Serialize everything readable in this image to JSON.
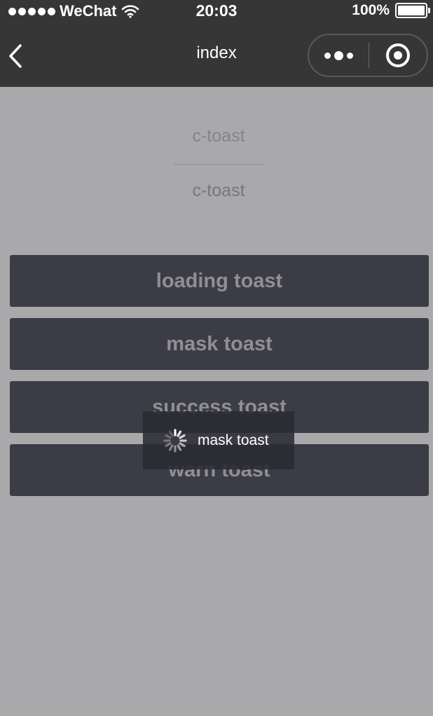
{
  "status_bar": {
    "carrier": "WeChat",
    "time": "20:03",
    "battery": "100%",
    "icons": [
      "signal-icon",
      "wifi-icon",
      "battery-icon"
    ]
  },
  "nav_bar": {
    "title": "index",
    "icons": [
      "back-icon",
      "more-icon",
      "target-icon"
    ]
  },
  "component": {
    "title": "c-toast",
    "subtitle": "c-toast"
  },
  "buttons": {
    "loading": "loading toast",
    "mask": "mask toast",
    "success": "success toast",
    "warn": "warn toast"
  },
  "toast": {
    "text": "mask toast",
    "icon": "spinner-icon"
  },
  "colors": {
    "page_background": "#a9a8aa",
    "bar_background": "#363636",
    "button_background": "#3c3c47",
    "toast_background": "#2a2a32"
  }
}
